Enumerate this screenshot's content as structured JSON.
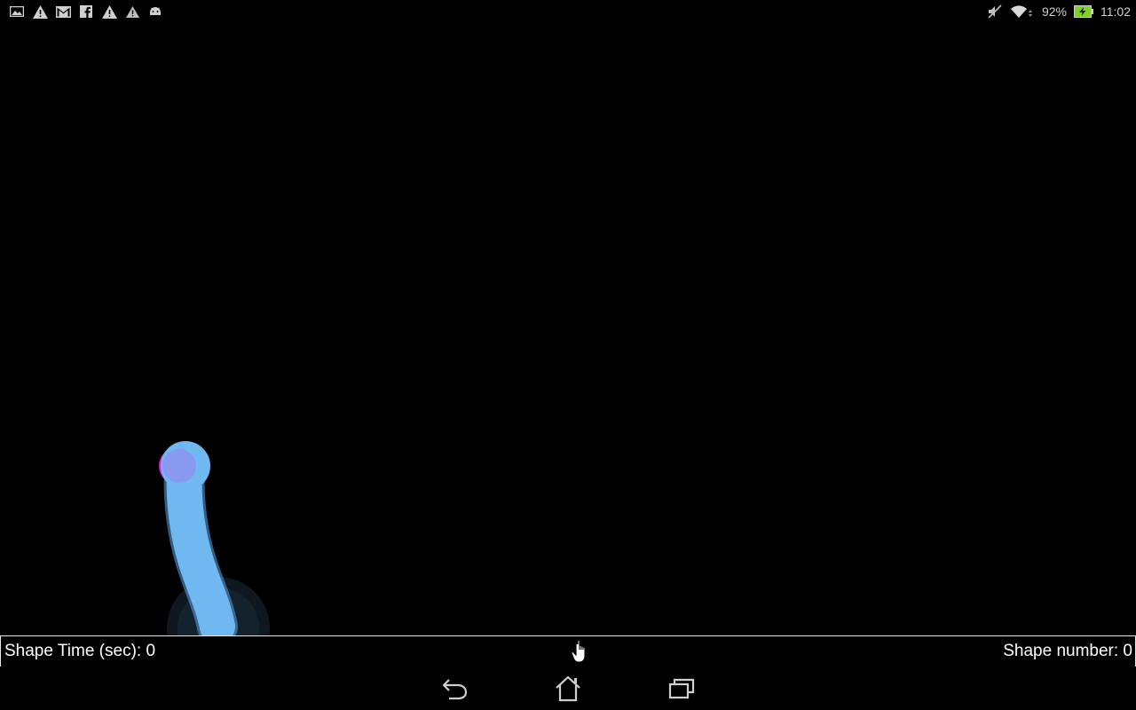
{
  "status_bar": {
    "notification_icons": [
      "gallery-icon",
      "warning-icon",
      "gmail-icon",
      "facebook-icon",
      "warning-icon",
      "alert-icon",
      "android-debug-icon"
    ],
    "system_icons": [
      "mute-icon",
      "wifi-icon"
    ],
    "battery_percent": "92%",
    "time": "11:02",
    "battery_color": "#7ed321"
  },
  "canvas": {
    "background": "#000000",
    "stroke_color": "#6fb8f0",
    "start_dot_color": "#e020d8",
    "touch_ring_color": "#1c2a36"
  },
  "info_bar": {
    "shape_time_label": "Shape Time (sec):",
    "shape_time_value": "0",
    "shape_number_label": "Shape number:",
    "shape_number_value": "0"
  },
  "nav_bar": {
    "buttons": [
      "back-icon",
      "home-icon",
      "recent-apps-icon"
    ]
  }
}
